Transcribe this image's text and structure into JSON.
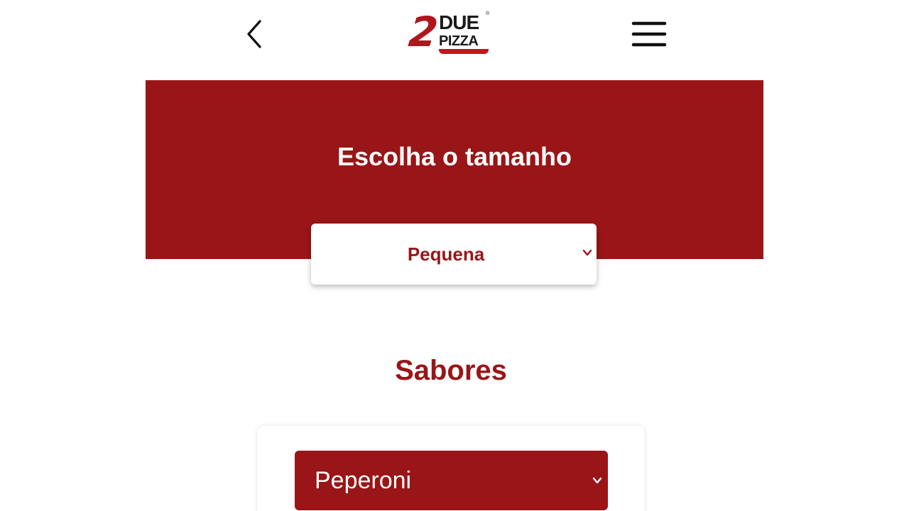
{
  "header": {
    "back_icon": "chevron-left-icon",
    "menu_icon": "hamburger-menu-icon",
    "logo": {
      "number": "2",
      "line1": "DUE",
      "line2": "PIZZA",
      "mark": "®"
    }
  },
  "hero": {
    "title": "Escolha o tamanho",
    "background_color": "#9a1517",
    "size_select": {
      "value": "Pequena",
      "chevron_icon": "chevron-down-icon"
    }
  },
  "flavors": {
    "title": "Sabores",
    "select": {
      "value": "Peperoni",
      "chevron_icon": "chevron-down-icon"
    }
  },
  "colors": {
    "brand_red": "#9a1517",
    "text_white": "#ffffff"
  }
}
